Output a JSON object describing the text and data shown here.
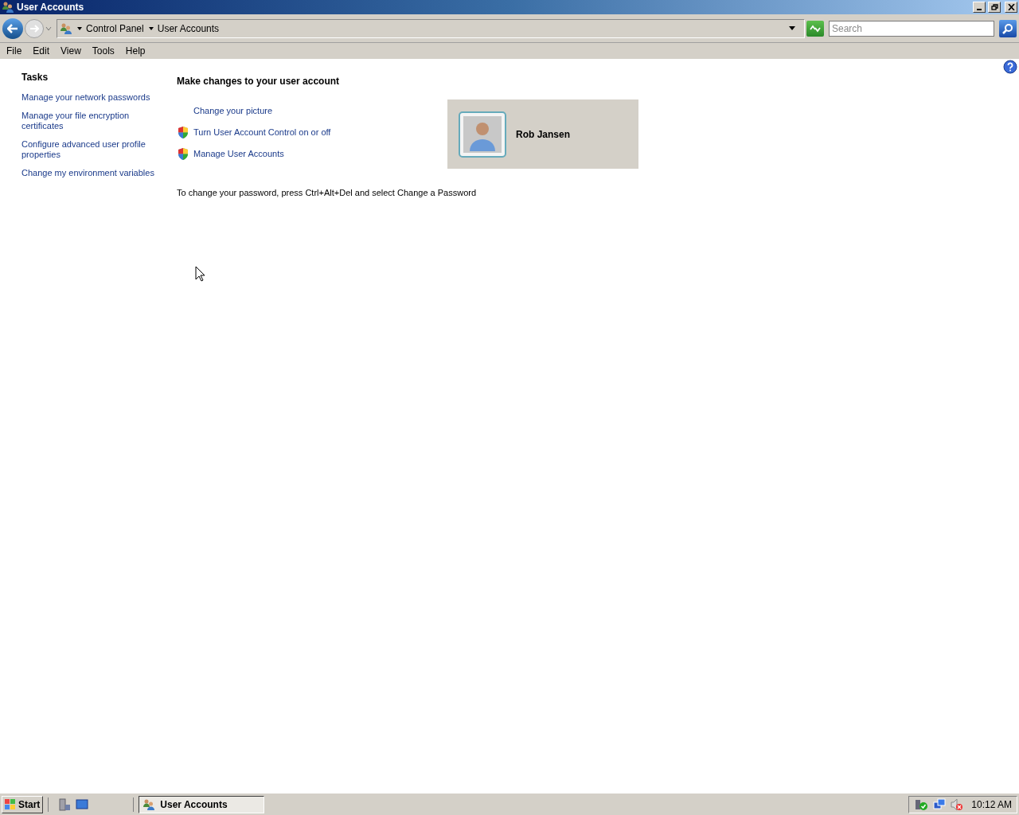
{
  "window": {
    "title": "User Accounts"
  },
  "address_bar": {
    "breadcrumb": [
      "Control Panel",
      "User Accounts"
    ],
    "search": {
      "placeholder": "Search"
    }
  },
  "menu": [
    "File",
    "Edit",
    "View",
    "Tools",
    "Help"
  ],
  "sidebar": {
    "title": "Tasks",
    "links": [
      "Manage your network passwords",
      "Manage your file encryption certificates",
      "Configure advanced user profile properties",
      "Change my environment variables"
    ]
  },
  "main": {
    "heading": "Make changes to your user account",
    "actions": [
      {
        "label": "Change your picture",
        "kind": "plain"
      },
      {
        "label": "Turn User Account Control on or off",
        "kind": "shield"
      },
      {
        "label": "Manage User Accounts",
        "kind": "shield"
      }
    ],
    "account": {
      "name": "Rob Jansen"
    },
    "note": "To change your password, press Ctrl+Alt+Del and select Change a Password"
  },
  "taskbar": {
    "start": "Start",
    "tasks": [
      {
        "label": "User Accounts",
        "selected": true
      }
    ],
    "clock": "10:12 AM"
  }
}
